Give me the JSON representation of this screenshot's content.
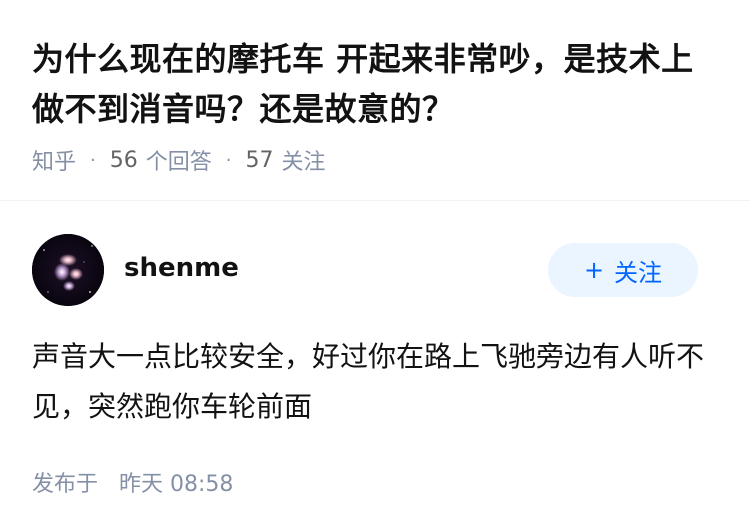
{
  "question": {
    "title": "为什么现在的摩托车 开起来非常吵，是技术上做不到消音吗？还是故意的？"
  },
  "meta": {
    "source": "知乎",
    "separator": "·",
    "answer_count": "56",
    "answer_label": "个回答",
    "follow_count": "57",
    "follow_label": "关注"
  },
  "answer": {
    "author_name": "shenme",
    "follow_button_label": "关注",
    "follow_button_icon": "plus-icon",
    "content": "声音大一点比较安全，好过你在路上飞驰旁边有人听不见，突然跑你车轮前面",
    "publish_label": "发布于",
    "publish_time": "昨天 08:58"
  },
  "colors": {
    "title": "#121212",
    "meta": "#8590a6",
    "accent": "#0066ff",
    "follow_bg": "#ebf5ff"
  }
}
